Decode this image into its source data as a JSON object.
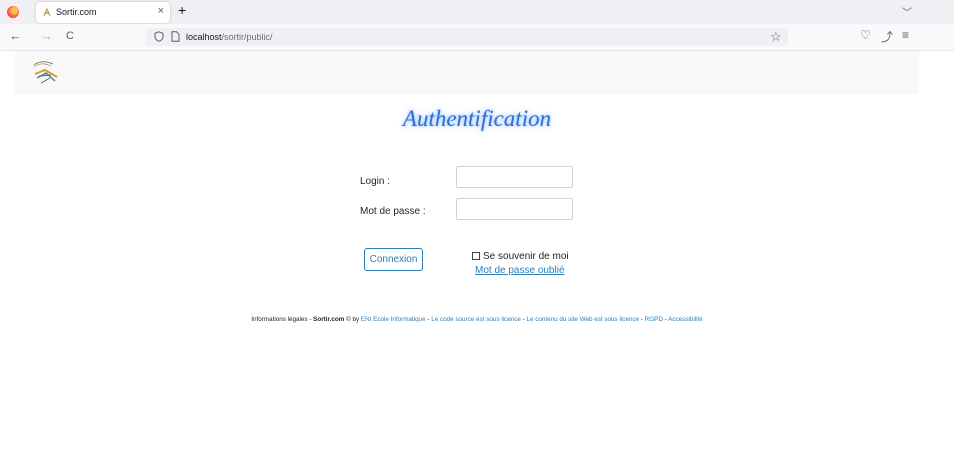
{
  "browser": {
    "tab_title": "Sortir.com",
    "tab_close": "×",
    "new_tab": "+",
    "tab_list": "﹀",
    "back": "←",
    "forward": "→",
    "reload": "C",
    "url_host": "localhost",
    "url_path": "/sortir/public/",
    "bookmark": "☆",
    "pocket": "♡",
    "extensions": "⤴",
    "menu": "≡"
  },
  "page": {
    "title": "Authentification",
    "login_label": "Login :",
    "login_value": "",
    "password_label": "Mot de passe :",
    "password_value": "",
    "submit_label": "Connexion",
    "remember_label": "Se souvenir de moi",
    "forgot_label": "Mot de passe oublié"
  },
  "footer": {
    "prefix": "Informations légales - ",
    "brand": "Sortir.com",
    "by": " © by ",
    "link_eni": "ENI Ecole Informatique",
    "link_code": "Le code source est sous licence",
    "link_content": "Le contenu du site Web est sous licence",
    "link_rgpd": "RGPD",
    "link_access": "Accessibilité",
    "separator": " - "
  },
  "colors": {
    "accent": "#2a7fb8",
    "title": "#2f6fcf"
  }
}
